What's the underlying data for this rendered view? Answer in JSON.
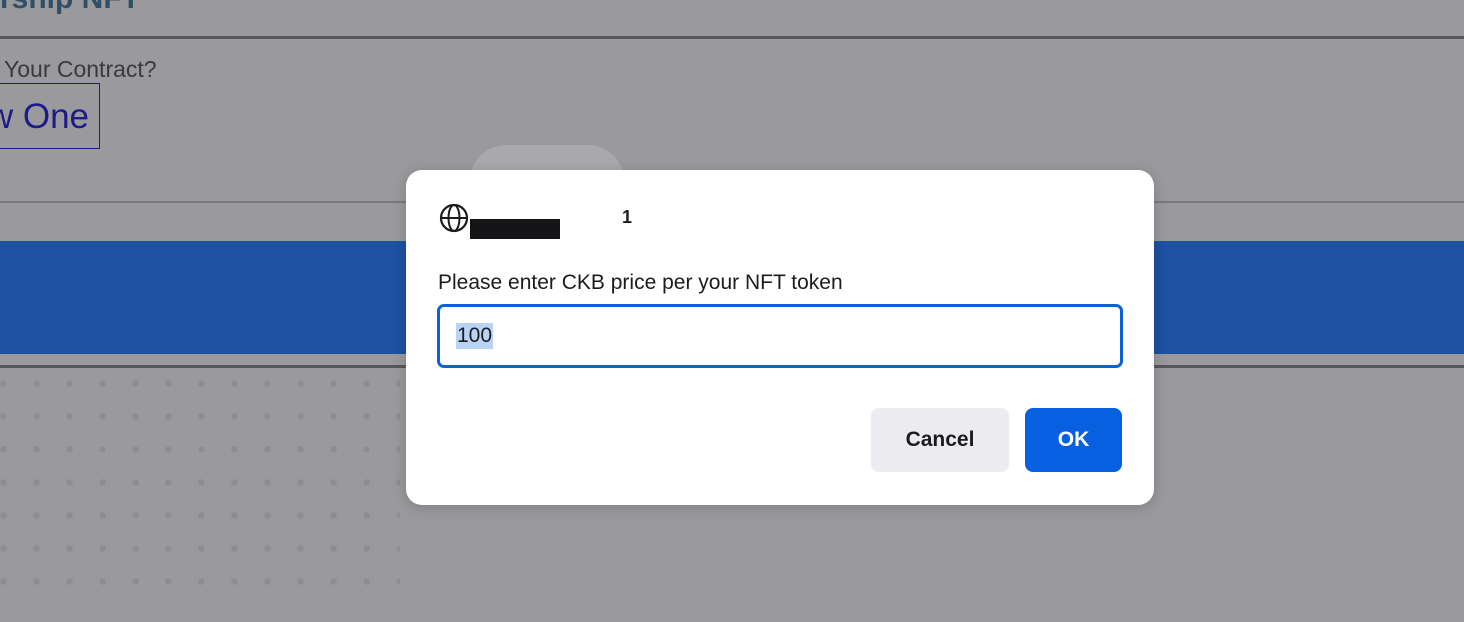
{
  "background_page": {
    "heading_fragment": "rship NFT",
    "question_fragment": "Your Contract?",
    "new_button_fragment": "w One"
  },
  "dialog": {
    "origin_suffix": "1",
    "prompt_text": "Please enter CKB price per your NFT token",
    "input_value": "100",
    "cancel_label": "Cancel",
    "ok_label": "OK"
  },
  "icons": {
    "origin": "globe-icon"
  },
  "colors": {
    "accent_blue": "#0760e0",
    "band_blue": "#1d52a2",
    "link_color": "#1e1a8a",
    "heading_color": "#2f4f66"
  }
}
